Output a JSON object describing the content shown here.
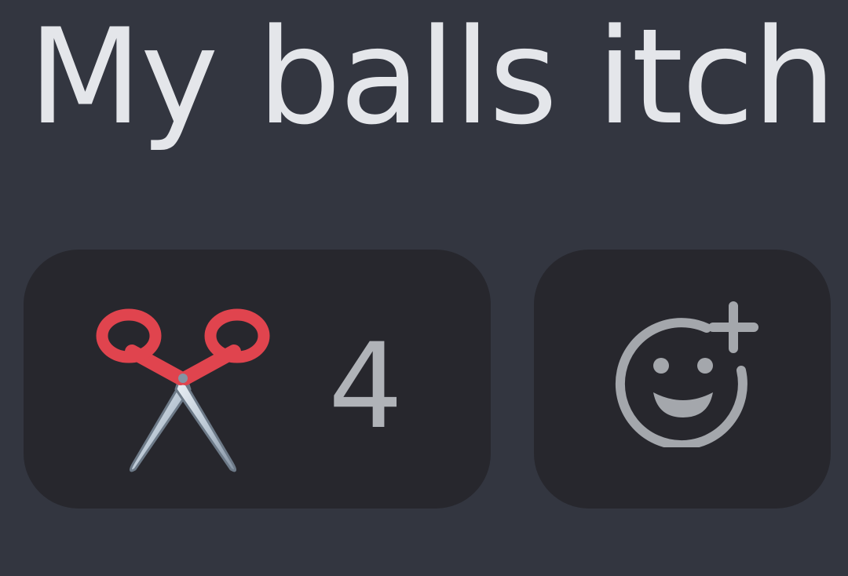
{
  "message": {
    "text": "My balls itch"
  },
  "reactions": [
    {
      "emoji": "scissors",
      "icon": "scissors-icon",
      "count": "4"
    }
  ],
  "add_reaction": {
    "icon": "add-reaction-icon"
  },
  "colors": {
    "background": "#333640",
    "reaction_pill": "#27272d",
    "message_text": "#e4e6ea",
    "count_text": "#b0b3b8",
    "icon_gray": "#a4a7ac",
    "scissors_handle": "#e0444e"
  }
}
